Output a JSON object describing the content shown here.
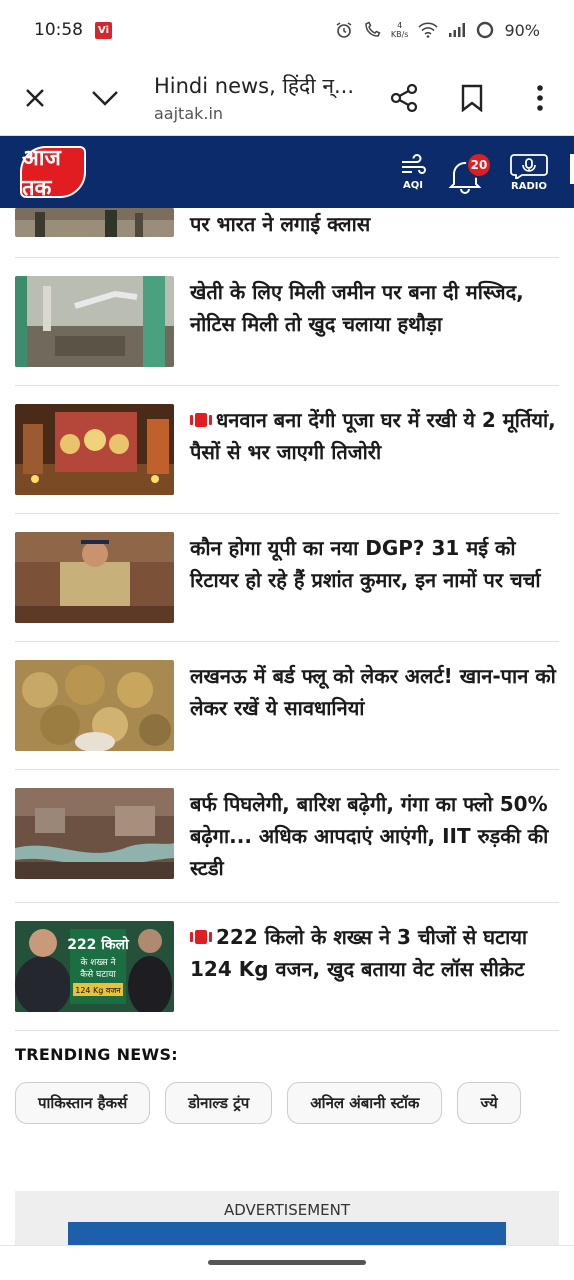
{
  "status_bar": {
    "time": "10:58",
    "vi_badge": "Vi",
    "speed_value": "4",
    "speed_unit": "KB/s",
    "battery": "90%"
  },
  "browser": {
    "title": "Hindi news, हिंदी न्...",
    "url": "aajtak.in"
  },
  "site_header": {
    "logo_text": "आज तक",
    "aqi_label": "AQI",
    "notification_count": "20",
    "radio_label": "RADIO",
    "bg_color": "#0c2b6b",
    "accent_color": "#e11d22"
  },
  "articles": [
    {
      "headline": "पर भारत ने लगाई क्लास",
      "video": false
    },
    {
      "headline": "खेती के लिए मिली जमीन पर बना दी मस्जिद, नोटिस मिली तो खुद चलाया हथौड़ा",
      "video": false
    },
    {
      "headline": "धनवान बना देंगी पूजा घर में रखी ये 2 मूर्तियां, पैसों से भर जाएगी तिजोरी",
      "video": true
    },
    {
      "headline": "कौन होगा यूपी का नया DGP? 31 मई को रिटायर हो रहे हैं प्रशांत कुमार, इन नामों पर चर्चा",
      "video": false
    },
    {
      "headline": "लखनऊ में बर्ड फ्लू को लेकर अलर्ट! खान-पान को लेकर रखें ये सावधानियां",
      "video": false
    },
    {
      "headline": "बर्फ पिघलेगी, बारिश बढ़ेगी, गंगा का फ्लो 50% बढ़ेगा... अधिक आपदाएं आएंगी, IIT रुड़की की स्टडी",
      "video": false
    },
    {
      "headline": "222 किलो के शख्स ने 3 चीजों से घटाया 124 Kg वजन, खुद बताया वेट लॉस सीक्रेट",
      "video": true
    }
  ],
  "trending": {
    "title": "TRENDING NEWS:",
    "chips": [
      "पाकिस्तान हैकर्स",
      "डोनाल्ड ट्रंप",
      "अनिल अंबानी स्टॉक",
      "ज्ये"
    ]
  },
  "advertisement": {
    "label": "ADVERTISEMENT"
  },
  "thumb_text": {
    "kg": "222 किलो",
    "sub1": "के शख्स ने",
    "sub2": "कैसे घटाया",
    "sub3": "124 Kg वजन"
  }
}
